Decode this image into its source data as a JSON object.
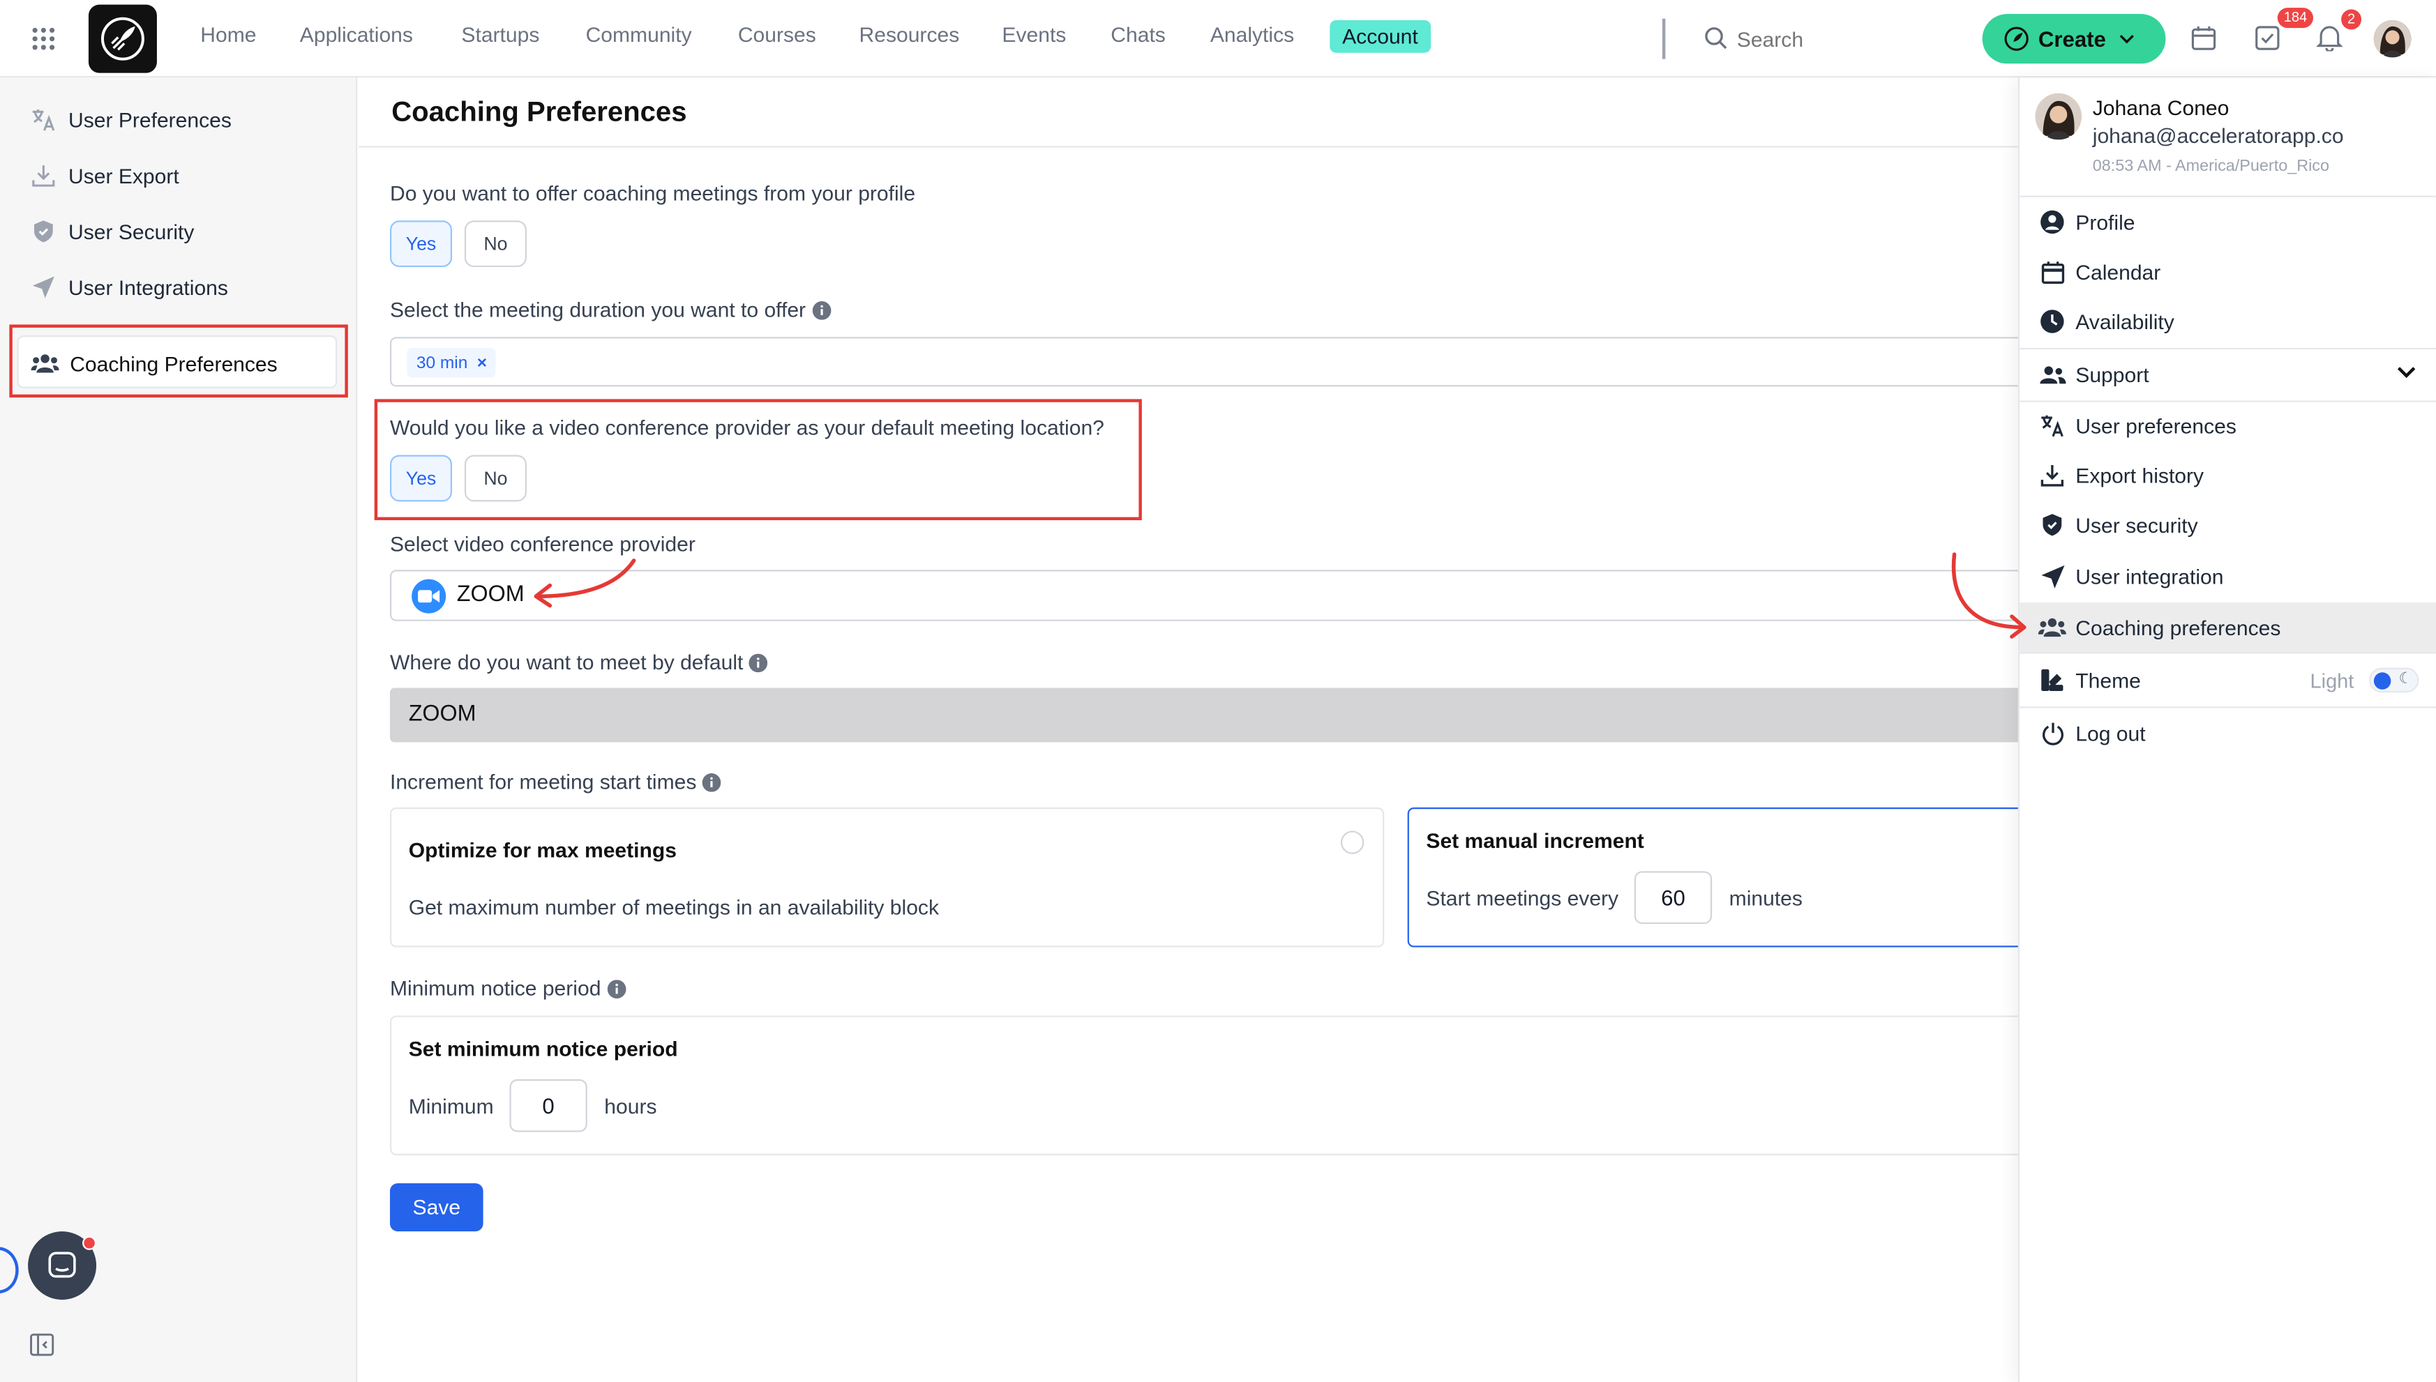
{
  "topbar": {
    "nav": [
      "Home",
      "Applications",
      "Startups",
      "Community",
      "Courses",
      "Resources",
      "Events",
      "Chats",
      "Analytics",
      "Account"
    ],
    "active_nav": "Account",
    "search_placeholder": "Search",
    "create_label": "Create",
    "tasks_badge": "184",
    "notifications_badge": "2"
  },
  "sidebar": {
    "items": [
      "User Preferences",
      "User Export",
      "User Security",
      "User Integrations",
      "Coaching Preferences"
    ],
    "active_item": "Coaching Preferences"
  },
  "main": {
    "title": "Coaching Preferences",
    "offer_question": "Do you want to offer coaching meetings from your profile",
    "yes": "Yes",
    "no": "No",
    "duration_label": "Select the meeting duration you want to offer",
    "duration_tag": "30 min",
    "duration_tag_remove": "×",
    "video_question": "Would you like a video conference provider as your default meeting location?",
    "provider_label": "Select video conference provider",
    "provider_value": "ZOOM",
    "meet_label": "Where do you want to meet by default",
    "meet_value": "ZOOM",
    "increment_label": "Increment for meeting start times",
    "optimize_title": "Optimize for max meetings",
    "optimize_desc": "Get maximum number of meetings in an availability block",
    "manual_title": "Set manual increment",
    "manual_prefix": "Start meetings every",
    "manual_value": "60",
    "manual_suffix": "minutes",
    "notice_label": "Minimum notice period",
    "notice_title": "Set minimum notice period",
    "notice_prefix": "Minimum",
    "notice_value": "0",
    "notice_suffix": "hours",
    "save_label": "Save"
  },
  "dropdown": {
    "user_name": "Johana Coneo",
    "user_email": "johana@acceleratorapp.co",
    "user_time": "08:53 AM - America/Puerto_Rico",
    "items_top": [
      "Profile",
      "Calendar",
      "Availability"
    ],
    "support_label": "Support",
    "items_support": [
      "User preferences",
      "Export history",
      "User security",
      "User integration",
      "Coaching preferences"
    ],
    "theme_label": "Theme",
    "theme_value": "Light",
    "logout_label": "Log out"
  },
  "colors": {
    "accent_teal": "#5eead4",
    "create_green": "#34d399",
    "primary_blue": "#2563eb",
    "annotation_red": "#e53935"
  }
}
